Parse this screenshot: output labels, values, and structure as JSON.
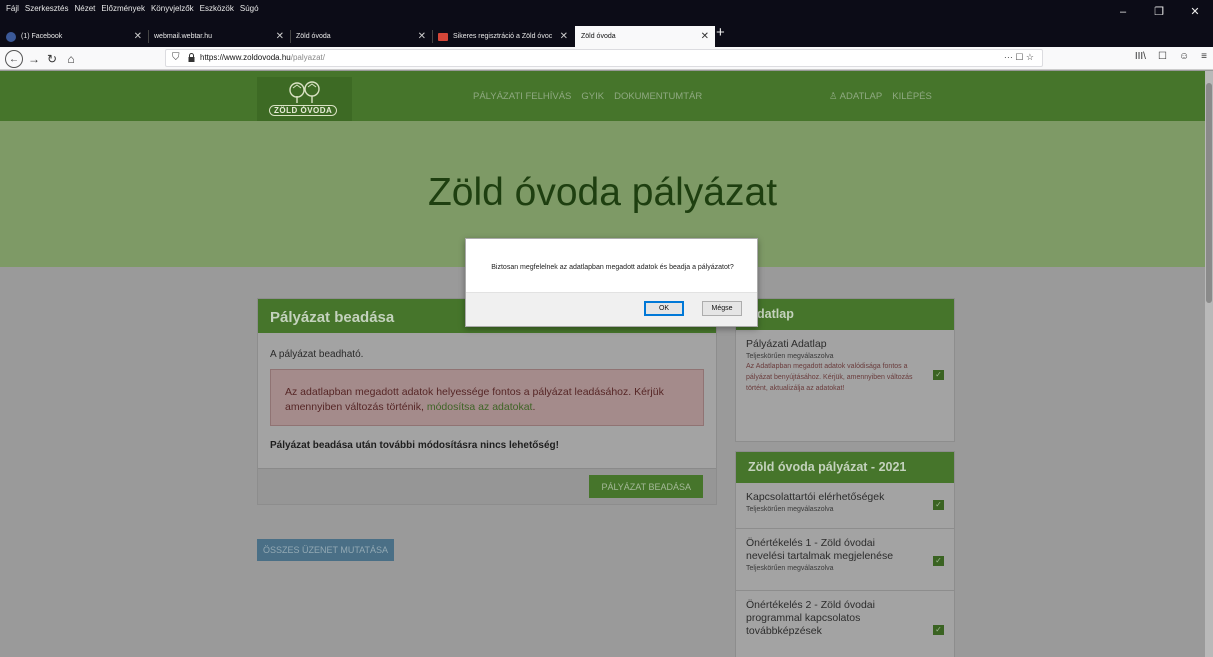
{
  "browser": {
    "menu": [
      "Fájl",
      "Szerkesztés",
      "Nézet",
      "Előzmények",
      "Könyvjelzők",
      "Eszközök",
      "Súgó"
    ],
    "window_controls": {
      "minimize": "–",
      "maximize": "❐",
      "close": "✕"
    },
    "tabs": [
      {
        "label": "(1) Facebook",
        "active": false,
        "favicon_color": "#3b5998"
      },
      {
        "label": "webmail.webtar.hu",
        "active": false
      },
      {
        "label": "Zöld óvoda",
        "active": false
      },
      {
        "label": "Sikeres regisztráció a Zöld óvoc",
        "active": false,
        "favicon_color": "#d44638"
      },
      {
        "label": "Zöld óvoda",
        "active": true
      }
    ],
    "new_tab": "+",
    "url_host": "https://www.zoldovoda.hu",
    "url_path": "/palyazat/",
    "url_right": "··· ☐ ☆",
    "toolbar_icons": [
      "III\\",
      "☐",
      "☺",
      "≡"
    ]
  },
  "site": {
    "logo_text": "ZÖLD ÓVODA",
    "nav": [
      "PÁLYÁZATI FELHÍVÁS",
      "GYIK",
      "DOKUMENTUMTÁR"
    ],
    "nav_right": [
      "♙ ADATLAP",
      "KILÉPÉS"
    ],
    "hero_title": "Zöld óvoda pályázat"
  },
  "submission": {
    "title": "Pályázat beadása",
    "status": "A pályázat beadható.",
    "alert_text": "Az adatlapban megadott adatok helyessége fontos a pályázat leadásához. Kérjük amennyiben változás történik, ",
    "alert_link": "módosítsa az adatokat",
    "alert_end": ".",
    "warning": "Pályázat beadása után további módosításra nincs lehetőség!",
    "submit_button": "PÁLYÁZAT BEADÁSA",
    "all_messages_button": "ÖSSZES ÜZENET MUTATÁSA"
  },
  "adatlap_card": {
    "title": "Adatlap",
    "item_title": "Pályázati Adatlap",
    "item_status": "Teljeskörűen megválaszolva",
    "item_warning": "Az Adatlapban megadott adatok valódisága fontos a pályázat benyújtásához. Kérjük, amennyiben változás történt, aktualizálja az adatokat!"
  },
  "palyazat_card": {
    "title": "Zöld óvoda pályázat - 2021",
    "items": [
      {
        "title": "Kapcsolattartói elérhetőségek",
        "status": "Teljeskörűen megválaszolva"
      },
      {
        "title": "Önértékelés 1 - Zöld óvodai nevelési tartalmak megjelenése",
        "status": "Teljeskörűen megválaszolva"
      },
      {
        "title": "Önértékelés 2 - Zöld óvodai programmal kapcsolatos továbbképzések",
        "status": ""
      }
    ]
  },
  "dialog": {
    "message": "Biztosan megfelelnek az adatlapban megadott adatok és beadja a pályázatot?",
    "ok": "OK",
    "cancel": "Mégse"
  }
}
